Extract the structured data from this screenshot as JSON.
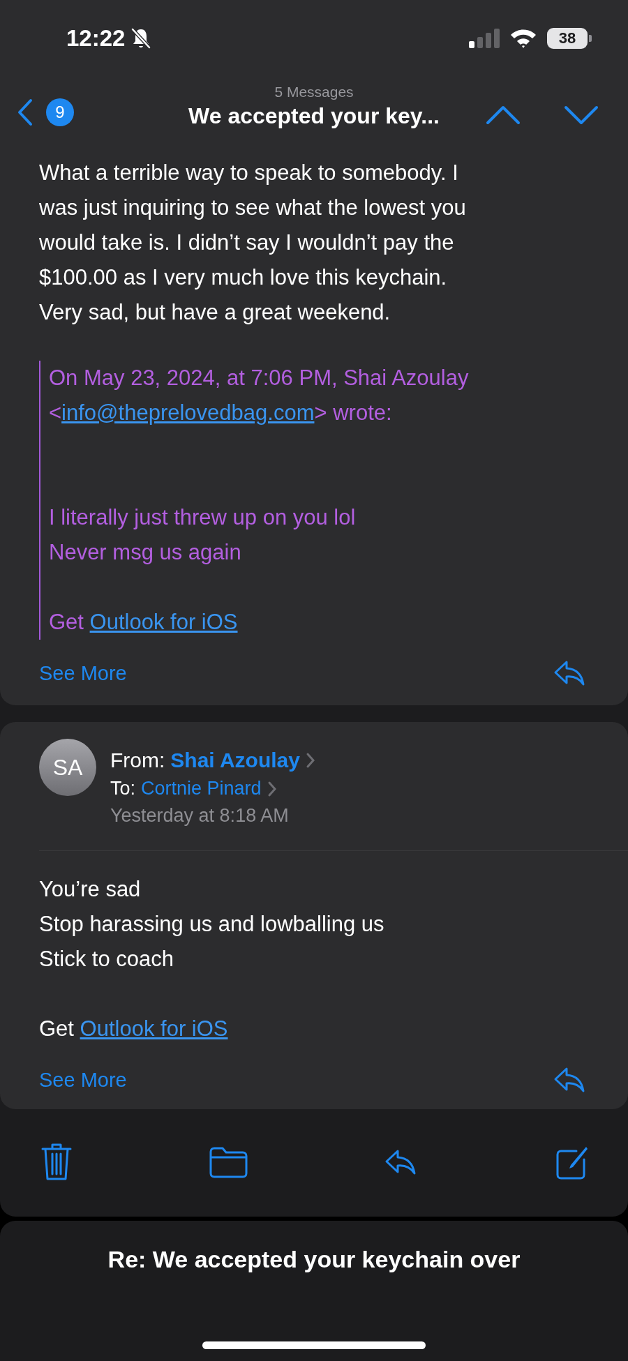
{
  "status_bar": {
    "time": "12:22",
    "battery": "38"
  },
  "header": {
    "unread_count": "9",
    "message_count": "5 Messages",
    "title": "We accepted your key..."
  },
  "messages": [
    {
      "kind": "continued",
      "body_lines": [
        "What a terrible way to speak to somebody. I",
        "was just inquiring to see what the lowest you",
        "would take is. I didn’t say I wouldn’t pay the",
        "$100.00 as I very much love this keychain.",
        "Very sad, but have a great weekend."
      ],
      "quote": {
        "attribution": "On May 23, 2024, at 7:06 PM, Shai Azoulay",
        "email_prefix": "<",
        "email": "info@theprelovedbag.com",
        "email_suffix": "> wrote:",
        "lines": [
          "I literally just threw up on you lol",
          "Never msg us again"
        ],
        "signature": {
          "text": "Get",
          "link": "Outlook for iOS"
        }
      },
      "see_more": "See More"
    },
    {
      "kind": "full",
      "avatar": "SA",
      "from_label": "From:",
      "from": "Shai Azoulay",
      "to_label": "To:",
      "to": "Cortnie Pinard",
      "date": "Yesterday at 8:18 AM",
      "body_lines": [
        "You’re sad",
        "Stop harassing us and lowballing us",
        "Stick to coach"
      ],
      "signature": {
        "text": "Get",
        "link": "Outlook for iOS"
      },
      "see_more": "See More"
    }
  ],
  "bottom_sheet": {
    "title": "Re: We accepted your keychain over"
  }
}
